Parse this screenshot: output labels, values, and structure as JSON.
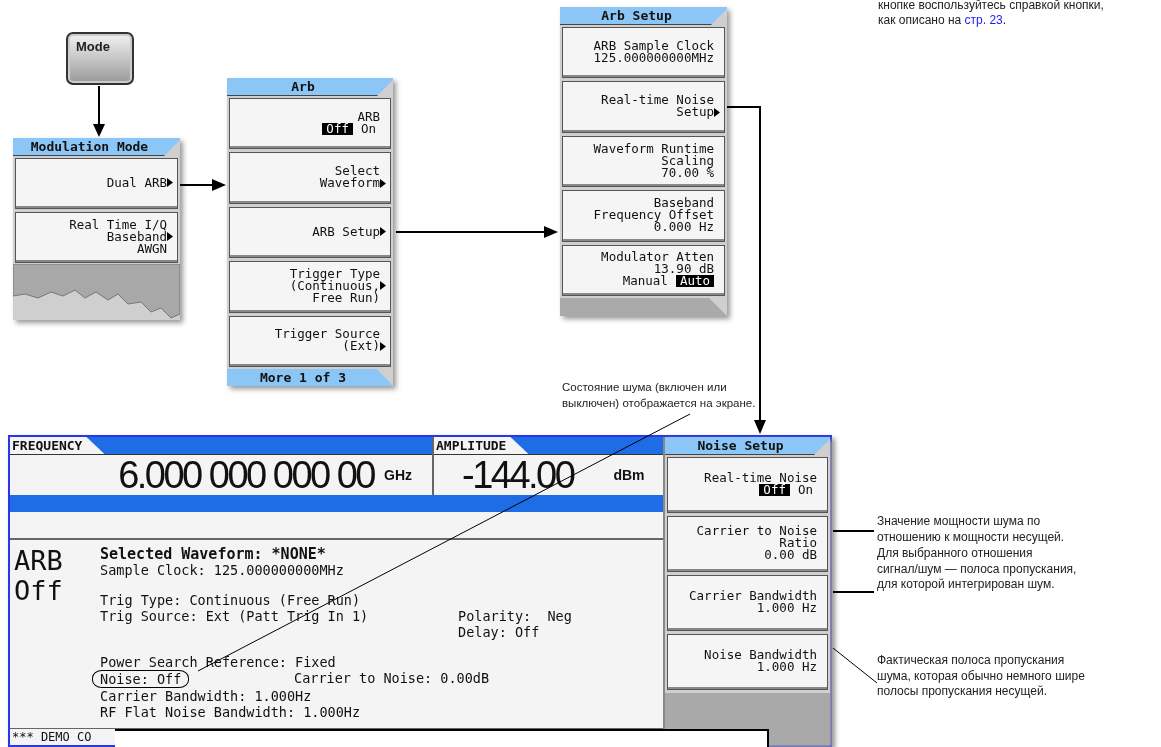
{
  "top_note": {
    "lines": [
      "кнопке воспользуйтесь справкой кнопки,",
      "как описано на"
    ],
    "link": "стр. 23",
    "end": "."
  },
  "mode_key": {
    "label": "Mode"
  },
  "menus": [
    {
      "title": "Modulation Mode",
      "keys": [
        {
          "kind": "plain",
          "lines": [
            {
              "text": "Dual ARB",
              "arrow": true
            }
          ]
        },
        {
          "kind": "plain",
          "lines": [
            {
              "text": "Real Time I/Q",
              "arrow": false
            },
            {
              "text": "Baseband",
              "arrow": true
            },
            {
              "text": "AWGN",
              "arrow": false
            }
          ]
        }
      ],
      "bottom": {
        "kind": "torn"
      }
    },
    {
      "title": "Arb",
      "keys": [
        {
          "kind": "toggle",
          "lines": [
            {
              "text": "ARB",
              "arrow": false
            }
          ],
          "options": [
            {
              "label": "Off",
              "selected": true
            },
            {
              "label": "On",
              "selected": false
            }
          ]
        },
        {
          "kind": "plain",
          "lines": [
            {
              "text": "Select",
              "arrow": false
            },
            {
              "text": "Waveform",
              "arrow": true
            }
          ]
        },
        {
          "kind": "plain",
          "lines": [
            {
              "text": "ARB Setup",
              "arrow": true
            }
          ]
        },
        {
          "kind": "plain",
          "lines": [
            {
              "text": "Trigger Type",
              "arrow": false
            },
            {
              "text": "(Continuous,",
              "arrow": true
            },
            {
              "text": "Free Run)",
              "arrow": false
            }
          ]
        },
        {
          "kind": "plain",
          "lines": [
            {
              "text": "Trigger Source",
              "arrow": false
            },
            {
              "text": "(Ext)",
              "arrow": true
            }
          ]
        }
      ],
      "bottom": {
        "kind": "more",
        "label": "More 1 of 3"
      }
    },
    {
      "title": "Arb Setup",
      "keys": [
        {
          "kind": "plain",
          "lines": [
            {
              "text": "ARB Sample Clock",
              "arrow": false
            },
            {
              "text": "125.000000000MHz",
              "arrow": false
            }
          ]
        },
        {
          "kind": "plain",
          "lines": [
            {
              "text": "Real-time Noise",
              "arrow": false
            },
            {
              "text": "Setup",
              "arrow": true
            }
          ]
        },
        {
          "kind": "plain",
          "lines": [
            {
              "text": "Waveform Runtime",
              "arrow": false
            },
            {
              "text": "Scaling",
              "arrow": false
            },
            {
              "text": "70.00 %",
              "arrow": false
            }
          ]
        },
        {
          "kind": "plain",
          "lines": [
            {
              "text": "Baseband",
              "arrow": false
            },
            {
              "text": "Frequency Offset",
              "arrow": false
            },
            {
              "text": "0.000 Hz",
              "arrow": false
            }
          ]
        },
        {
          "kind": "toggle",
          "lines": [
            {
              "text": "Modulator Atten",
              "arrow": false
            },
            {
              "text": "13.90 dB",
              "arrow": false
            }
          ],
          "options": [
            {
              "label": "Manual",
              "selected": false
            },
            {
              "label": "Auto",
              "selected": true
            }
          ]
        }
      ],
      "bottom": {
        "kind": "blank"
      }
    }
  ],
  "display": {
    "frequency": {
      "label": "FREQUENCY",
      "value": "6.000 000 000 00",
      "unit": "GHz"
    },
    "amplitude": {
      "label": "AMPLITUDE",
      "value": "-144.00",
      "unit": "dBm"
    },
    "mode_status": [
      "ARB",
      "Off"
    ],
    "blocks": [
      [
        {
          "kind": "heading",
          "text": "Selected Waveform: *NONE*"
        },
        {
          "kind": "line",
          "text": "Sample Clock: 125.000000000MHz"
        }
      ],
      [
        {
          "kind": "line",
          "text": "Trig Type: Continuous (Free Run)"
        },
        {
          "kind": "line",
          "text": "Trig Source: Ext (Patt Trig In 1)",
          "aside": "Polarity:  Neg"
        },
        {
          "kind": "line",
          "aside": "Delay: Off"
        }
      ],
      [
        {
          "kind": "line",
          "text": "Power Search Reference: Fixed"
        },
        {
          "kind": "circled",
          "text": "Noise: Off",
          "aside": "Carrier to Noise: 0.00dB"
        },
        {
          "kind": "line",
          "text": "Carrier Bandwidth: 1.000Hz"
        },
        {
          "kind": "line",
          "text": "RF Flat Noise Bandwidth: 1.000Hz"
        }
      ]
    ],
    "status_line": "*** DEMO CO",
    "menu": {
      "title": "Noise Setup",
      "keys": [
        {
          "kind": "toggle",
          "lines": [
            {
              "text": "Real-time Noise",
              "arrow": false
            }
          ],
          "options": [
            {
              "label": "Off",
              "selected": true
            },
            {
              "label": "On",
              "selected": false
            }
          ]
        },
        {
          "kind": "plain",
          "lines": [
            {
              "text": "Carrier to Noise",
              "arrow": false
            },
            {
              "text": "Ratio",
              "arrow": false
            },
            {
              "text": "0.00 dB",
              "arrow": false
            }
          ]
        },
        {
          "kind": "plain",
          "lines": [
            {
              "text": "Carrier Bandwidth",
              "arrow": false
            },
            {
              "text": "1.000 Hz",
              "arrow": false
            }
          ]
        },
        {
          "kind": "plain",
          "lines": [
            {
              "text": "Noise Bandwidth",
              "arrow": false
            },
            {
              "text": "1.000 Hz",
              "arrow": false
            }
          ]
        }
      ],
      "bottom": {
        "kind": "fill"
      }
    }
  },
  "callouts": [
    {
      "lines": [
        "Состояние шума (включен или",
        "выключен) отображается на экране."
      ]
    },
    {
      "lines": [
        "Значение мощности шума по",
        "отношению к мощности несущей."
      ]
    },
    {
      "lines": [
        "Для выбранного отношения",
        "сигнал/шум — полоса пропускания,",
        "для которой интегрирован шум."
      ]
    },
    {
      "lines": [
        "Фактическая полоса пропускания",
        "шума, которая обычно немного шире",
        "полосы пропускания несущей."
      ]
    }
  ]
}
